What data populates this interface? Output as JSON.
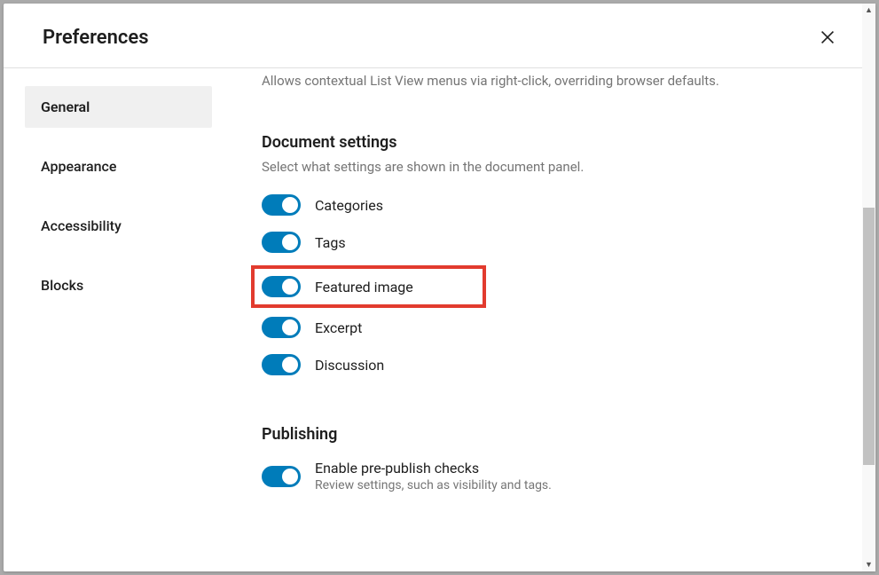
{
  "header": {
    "title": "Preferences"
  },
  "sidebar": {
    "items": [
      {
        "label": "General",
        "active": true
      },
      {
        "label": "Appearance",
        "active": false
      },
      {
        "label": "Accessibility",
        "active": false
      },
      {
        "label": "Blocks",
        "active": false
      }
    ]
  },
  "content": {
    "prev_hint": "Allows contextual List View menus via right-click, overriding browser defaults.",
    "document_settings": {
      "title": "Document settings",
      "desc": "Select what settings are shown in the document panel.",
      "options": [
        {
          "label": "Categories",
          "on": true
        },
        {
          "label": "Tags",
          "on": true
        },
        {
          "label": "Featured image",
          "on": true,
          "highlighted": true
        },
        {
          "label": "Excerpt",
          "on": true
        },
        {
          "label": "Discussion",
          "on": true
        }
      ]
    },
    "publishing": {
      "title": "Publishing",
      "option": {
        "label": "Enable pre-publish checks",
        "sub": "Review settings, such as visibility and tags.",
        "on": true
      }
    }
  }
}
